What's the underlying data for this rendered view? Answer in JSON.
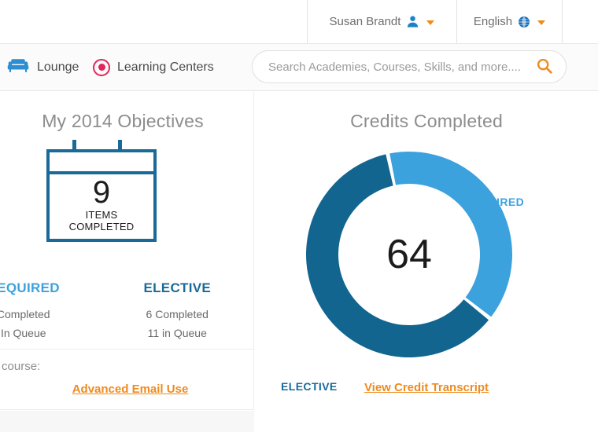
{
  "utility_bar": {
    "user": {
      "name": "Susan Brandt",
      "icon": "user-icon",
      "chevron": "chevron-down-icon"
    },
    "language": {
      "name": "English",
      "icon": "globe-icon",
      "chevron": "chevron-down-icon"
    }
  },
  "nav": {
    "items": [
      {
        "label": "Lounge",
        "icon": "couch-icon"
      },
      {
        "label": "Learning Centers",
        "icon": "bullseye-icon"
      }
    ]
  },
  "search": {
    "placeholder": "Search Academies, Courses, Skills, and more....",
    "value": "",
    "icon": "search-icon"
  },
  "objectives_card": {
    "title": "My 2014 Objectives",
    "calendar": {
      "number": "9",
      "caption_line1": "ITEMS",
      "caption_line2": "COMPLETED"
    },
    "stats": [
      {
        "heading": "REQUIRED",
        "completed": "Completed",
        "queue": "In Queue",
        "color": "#3ba2dd"
      },
      {
        "heading": "ELECTIVE",
        "completed": "6 Completed",
        "queue": "11 in Queue",
        "color": "#1a6a97"
      }
    ],
    "footer_text": "e last course:",
    "footer_link": "Advanced Email Use"
  },
  "credits_card": {
    "title": "Credits Completed",
    "link": "View Credit Transcript"
  },
  "chart_data": {
    "type": "pie",
    "title": "Credits Completed",
    "center_value": "64",
    "labels": [
      "REQUIRED",
      "ELECTIVE"
    ],
    "values": [
      39,
      61
    ],
    "colors": [
      "#3ba2dd",
      "#11658f"
    ],
    "legend": "inline-annotations",
    "donut": true
  },
  "colors": {
    "accent_orange": "#ef8b20",
    "light_blue": "#3ba2dd",
    "dark_blue": "#1a6a97",
    "pink": "#e0265c"
  }
}
